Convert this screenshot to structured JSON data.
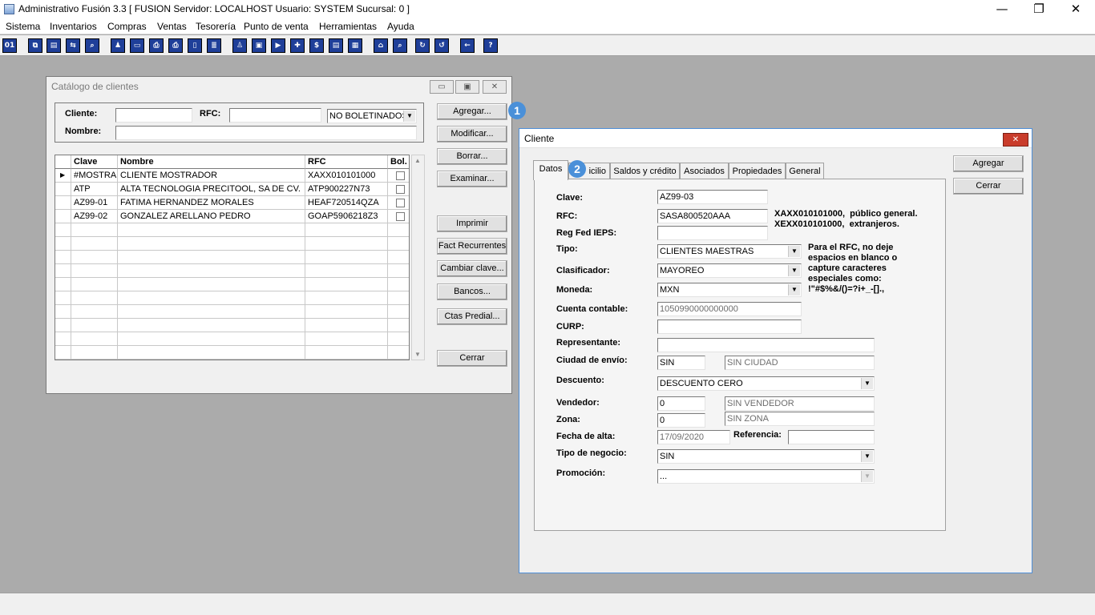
{
  "app": {
    "title": "Administrativo Fusión 3.3 [ FUSION  Servidor: LOCALHOST   Usuario: SYSTEM    Sucursal: 0 ]",
    "minimize": "—",
    "maximize": "❐",
    "close": "✕"
  },
  "menu": [
    "Sistema",
    "Inventarios",
    "Compras",
    "Ventas",
    "Tesorería",
    "Punto de venta",
    "Herramientas",
    "Ayuda"
  ],
  "toolbar_icons": [
    "calculator-icon",
    "copy-icon",
    "clipboard-icon",
    "transfer-icon",
    "search-doc-icon",
    "user-icon",
    "folder-icon",
    "print-icon",
    "printer-icon",
    "document-icon",
    "list-icon",
    "people-icon",
    "box-icon",
    "truck-icon",
    "add-icon",
    "money-icon",
    "report-icon",
    "sheet-icon",
    "home-icon",
    "zoom-icon",
    "refresh-icon",
    "undo-icon",
    "back-icon",
    "help-icon"
  ],
  "catalog": {
    "title": "Catálogo de clientes",
    "cliente_label": "Cliente:",
    "rfc_label": "RFC:",
    "nombre_label": "Nombre:",
    "filter_value": "NO BOLETINADOS",
    "columns": [
      "Clave",
      "Nombre",
      "RFC",
      "Bol."
    ],
    "rows": [
      {
        "clave": "#MOSTRA",
        "nombre": "CLIENTE MOSTRADOR",
        "rfc": "XAXX010101000",
        "selected": true
      },
      {
        "clave": "ATP",
        "nombre": "ALTA TECNOLOGIA PRECITOOL, SA DE CV.",
        "rfc": "ATP900227N73",
        "selected": false
      },
      {
        "clave": "AZ99-01",
        "nombre": "FATIMA HERNANDEZ MORALES",
        "rfc": "HEAF720514QZA",
        "selected": false
      },
      {
        "clave": "AZ99-02",
        "nombre": "GONZALEZ ARELLANO PEDRO",
        "rfc": "GOAP5906218Z3",
        "selected": false
      }
    ],
    "buttons": {
      "agregar": "Agregar...",
      "modificar": "Modificar...",
      "borrar": "Borrar...",
      "examinar": "Examinar...",
      "imprimir": "Imprimir",
      "fact_recurrentes": "Fact Recurrentes",
      "cambiar_clave": "Cambiar clave...",
      "bancos": "Bancos...",
      "ctas_predial": "Ctas Predial...",
      "cerrar": "Cerrar"
    }
  },
  "cliente": {
    "title": "Cliente",
    "tabs": [
      "Datos",
      "Domicilio",
      "Saldos y crédito",
      "Asociados",
      "Propiedades",
      "General"
    ],
    "tab_domicilio_visible": "icilio",
    "buttons": {
      "agregar": "Agregar",
      "cerrar": "Cerrar"
    },
    "labels": {
      "clave": "Clave:",
      "rfc": "RFC:",
      "reg_fed_ieps": "Reg Fed IEPS:",
      "tipo": "Tipo:",
      "clasificador": "Clasificador:",
      "moneda": "Moneda:",
      "cuenta_contable": "Cuenta contable:",
      "curp": "CURP:",
      "representante": "Representante:",
      "ciudad_envio": "Ciudad de envío:",
      "descuento": "Descuento:",
      "vendedor": "Vendedor:",
      "zona": "Zona:",
      "fecha_alta": "Fecha de alta:",
      "referencia": "Referencia:",
      "tipo_negocio": "Tipo de negocio:",
      "promocion": "Promoción:"
    },
    "values": {
      "clave": "AZ99-03",
      "rfc": "SASA800520AAA",
      "reg_fed_ieps": "",
      "tipo": "CLIENTES MAESTRAS",
      "clasificador": "MAYOREO",
      "moneda": "MXN",
      "cuenta_contable": "1050990000000000",
      "curp": "",
      "representante": "",
      "ciudad_clave": "SIN",
      "ciudad_nombre": "SIN CIUDAD",
      "descuento": "DESCUENTO CERO",
      "vendedor_clave": "0",
      "vendedor_nombre": "SIN VENDEDOR",
      "zona_clave": "0",
      "zona_nombre": "SIN ZONA",
      "fecha_alta": "17/09/2020",
      "referencia": "",
      "tipo_negocio": "SIN",
      "promocion": "..."
    },
    "notes": {
      "rfc_hint": "XAXX010101000,  público general.\nXEXX010101000,  extranjeros.",
      "rfc_rule": "Para el RFC, no deje\nespacios en blanco o\ncapture caracteres\nespeciales como:\n!\"#$%&/()=?i+_-[].,"
    }
  },
  "badges": [
    "1",
    "2"
  ]
}
